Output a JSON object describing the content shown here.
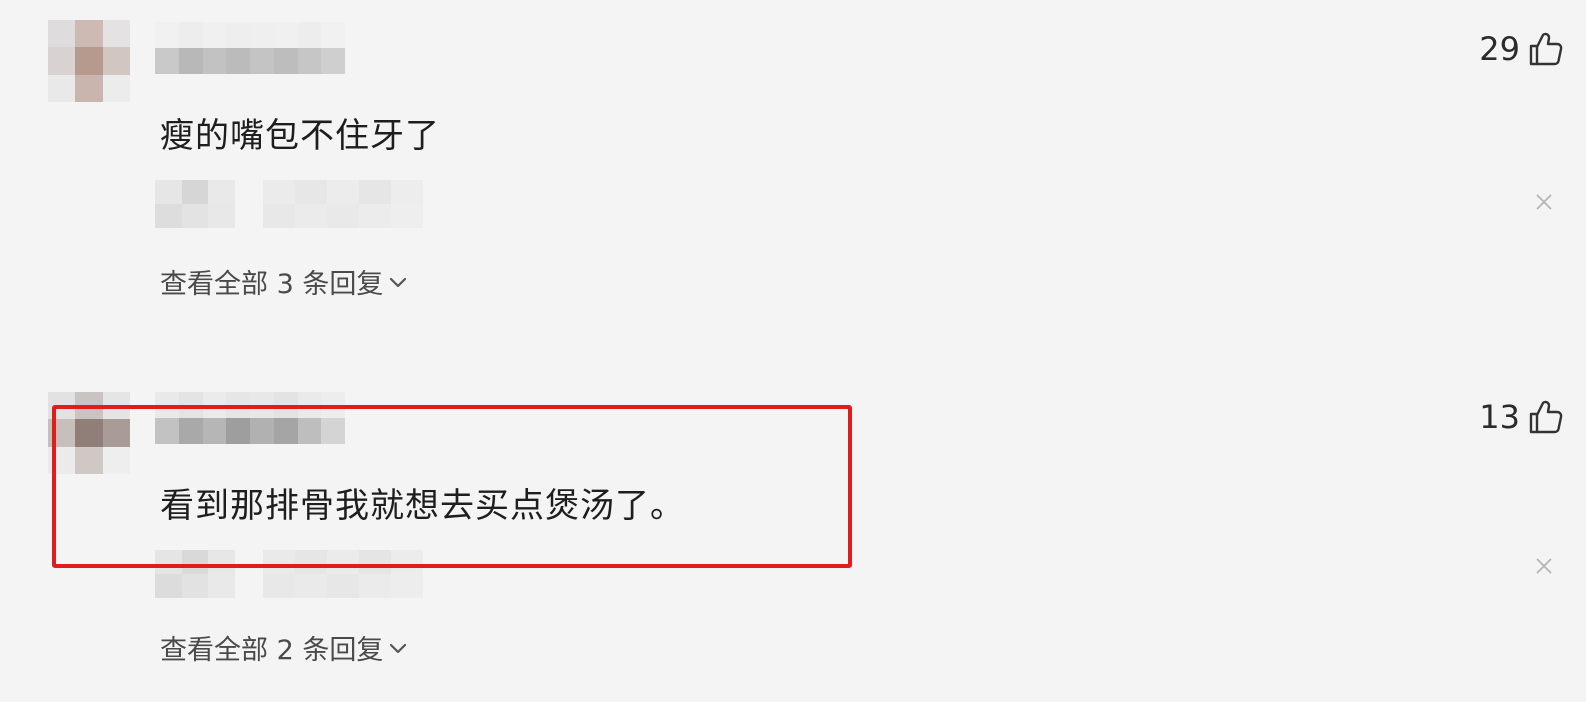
{
  "comments": [
    {
      "text": "瘦的嘴包不住牙了",
      "likes": "29",
      "replies_label": "查看全部 3 条回复"
    },
    {
      "text": "看到那排骨我就想去买点煲汤了。",
      "likes": "13",
      "replies_label": "查看全部 2 条回复"
    }
  ],
  "colors": {
    "background": "#f4f4f4",
    "highlight": "#e01c1c"
  },
  "icons": {
    "like": "thumbs-up-icon",
    "expand": "chevron-down-icon",
    "dismiss": "close-icon"
  }
}
